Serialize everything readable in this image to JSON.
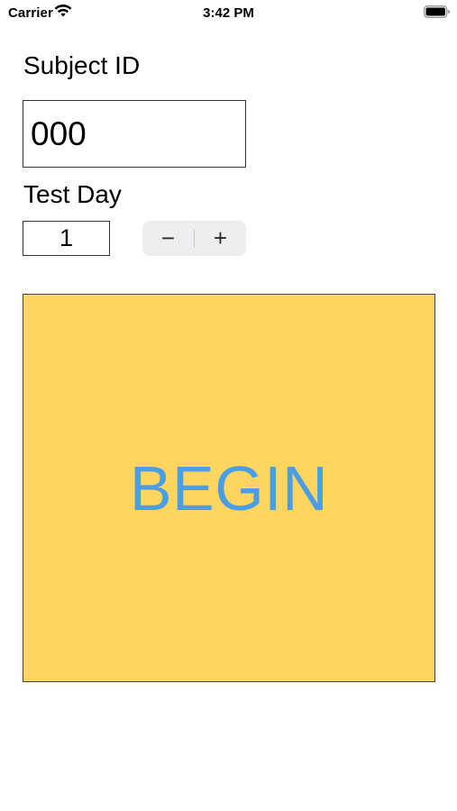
{
  "status_bar": {
    "carrier": "Carrier",
    "time": "3:42 PM",
    "wifi_icon": "wifi-icon",
    "battery_icon": "battery-full-icon"
  },
  "subject": {
    "label": "Subject ID",
    "value": "000"
  },
  "test_day": {
    "label": "Test Day",
    "value": "1",
    "decrement_label": "−",
    "increment_label": "+"
  },
  "begin": {
    "label": "BEGIN"
  },
  "colors": {
    "begin_background": "#fed55f",
    "begin_text": "#4a9ee6",
    "stepper_background": "#eeeef0"
  }
}
